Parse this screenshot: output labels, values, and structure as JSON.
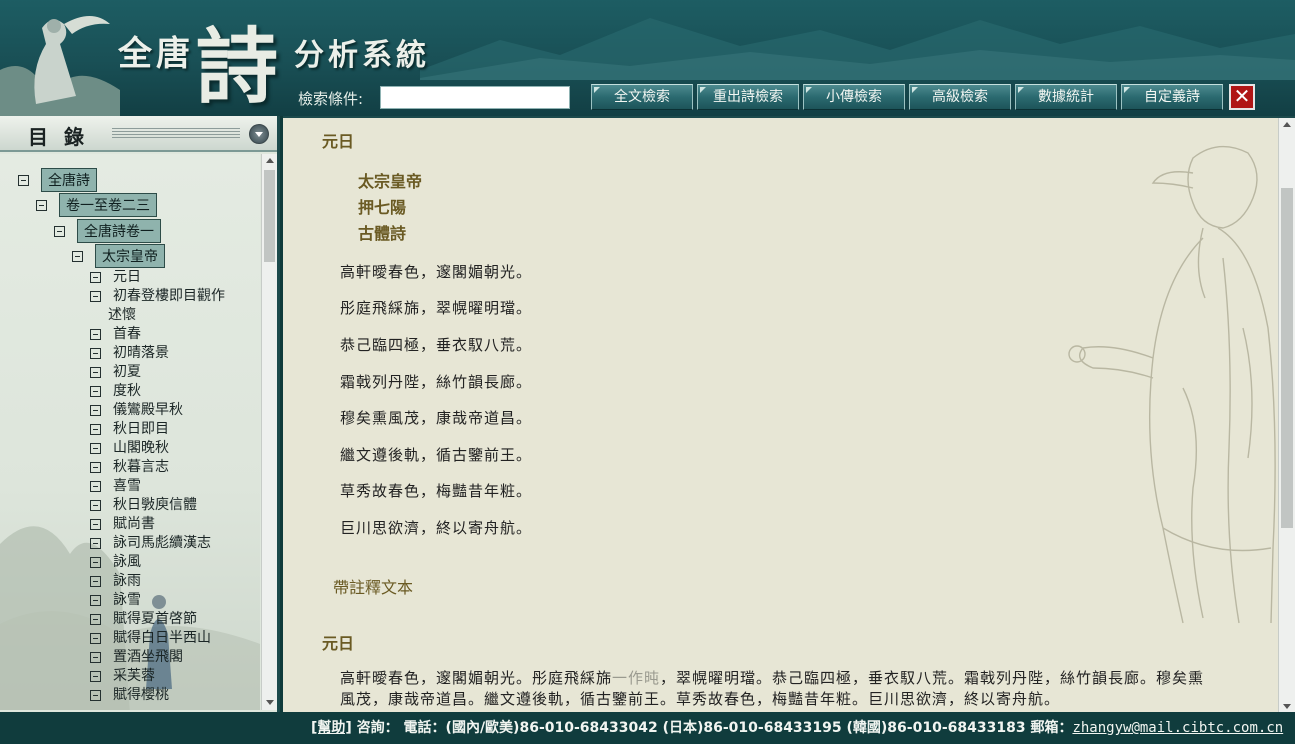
{
  "header": {
    "title_left": "全唐",
    "title_big": "詩",
    "title_right": "分析系統",
    "search_label": "檢索條件:",
    "search_value": "",
    "buttons": [
      "全文檢索",
      "重出詩檢索",
      "小傳檢索",
      "高級檢索",
      "數據統計",
      "自定義詩"
    ],
    "close_glyph": "✕"
  },
  "sidebar": {
    "title": "目錄",
    "tree": {
      "root": "全唐詩",
      "level1": "卷一至卷二三",
      "level2": "全唐詩卷一",
      "level3": "太宗皇帝",
      "items": [
        "元日",
        "初春登樓即目觀作",
        "述懷",
        "首春",
        "初晴落景",
        "初夏",
        "度秋",
        "儀鸞殿早秋",
        "秋日即目",
        "山閣晚秋",
        "秋暮言志",
        "喜雪",
        "秋日斅庾信體",
        "賦尚書",
        "詠司馬彪續漢志",
        "詠風",
        "詠雨",
        "詠雪",
        "賦得夏首啓節",
        "賦得白日半西山",
        "置酒坐飛閣",
        "采芙蓉",
        "賦得櫻桃"
      ]
    }
  },
  "main": {
    "poem_title": "元日",
    "author": "太宗皇帝",
    "rhyme": "押七陽",
    "form": "古體詩",
    "verses": [
      "高軒曖春色，邃閣媚朝光。",
      "彤庭飛綵旆，翠幌曜明璫。",
      "恭己臨四極，垂衣馭八荒。",
      "霜戟列丹陛，絲竹韻長廊。",
      "穆矣熏風茂，康哉帝道昌。",
      "繼文遵後軌，循古鑒前王。",
      "草秀故春色，梅豔昔年粧。",
      "巨川思欲濟，終以寄舟航。"
    ],
    "annot_link": "帶註釋文本",
    "annot_title": "元日",
    "para_part1": "高軒曖春色，邃閣媚朝光。彤庭飛綵旆",
    "para_variant": "一作旽",
    "para_part2": "，翠幌曜明璫。恭己臨四極，垂衣馭八荒。霜戟列丹陛，絲竹韻長廊。穆矣熏風茂，康哉帝道昌。繼文遵後軌，循古鑒前王。草秀故春色，梅豔昔年粧。巨川思欲濟，終以寄舟航。"
  },
  "footer": {
    "help": "[幫助]",
    "consult": "咨詢：",
    "phone": "電話：(國內/歐美)86-010-68433042 (日本)86-010-68433195 (韓國)86-010-68433183 郵箱：",
    "email": "zhangyw@mail.cibtc.com.cn"
  },
  "colors": {
    "header_bg": "#194f55",
    "accent_gold": "#6a5a23",
    "tree_highlight": "#8fb3ad",
    "close_red": "#b01616"
  }
}
